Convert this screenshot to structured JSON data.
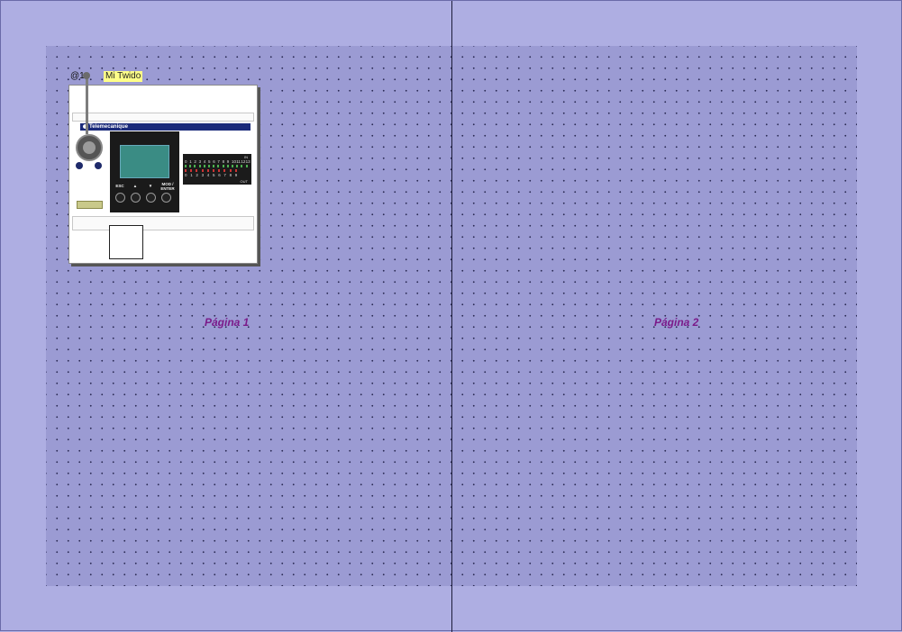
{
  "canvas": {
    "colors": {
      "background": "#aeaee2",
      "page": "#9b9bd3",
      "grid_dot": "#2b2b55",
      "page_label": "#7b1b8a",
      "tag_bg": "#ffff88"
    }
  },
  "pages": [
    {
      "label": "Página 1"
    },
    {
      "label": "Página 2"
    }
  ],
  "device": {
    "address": "@1",
    "name": "Mi Twido",
    "brand": "Telemecanique",
    "keys": [
      "ESC",
      "▲",
      "▼",
      "MOD / ENTER"
    ],
    "io": {
      "in_label": "IN",
      "out_label": "OUT",
      "inputs": [
        "0",
        "1",
        "2",
        "3",
        "4",
        "5",
        "6",
        "7",
        "8",
        "9",
        "10",
        "11",
        "12",
        "13"
      ],
      "outputs": [
        "0",
        "1",
        "2",
        "3",
        "4",
        "5",
        "6",
        "7",
        "8",
        "9"
      ]
    }
  }
}
